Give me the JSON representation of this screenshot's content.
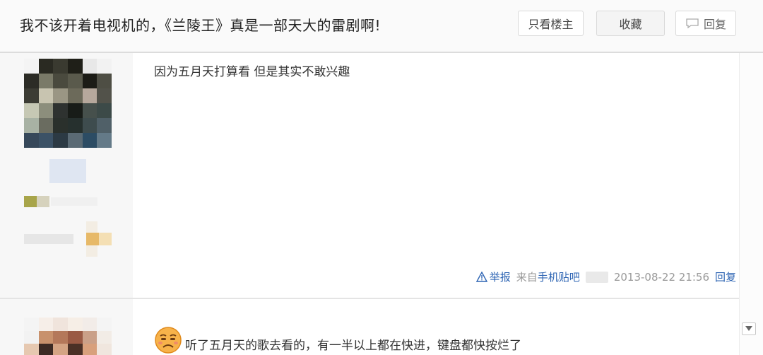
{
  "thread": {
    "title": "我不该开着电视机的，《兰陵王》真是一部天大的雷剧啊!",
    "buttons": {
      "only_owner": "只看楼主",
      "favorite": "收藏",
      "reply": "回复"
    }
  },
  "posts": [
    {
      "content": "因为五月天打算看 但是其实不敢兴趣",
      "tail": {
        "report": "举报",
        "source_prefix": "来自",
        "source": "手机贴吧",
        "datetime": "2013-08-22 21:56",
        "reply": "回复"
      }
    },
    {
      "content": "听了五月天的歌去看的，有一半以上都在快进，键盘都快按烂了",
      "emoji": "frowning-face"
    }
  ],
  "colors": {
    "link": "#2d64b3",
    "muted": "#999999",
    "author_bg": "#f7f7f7",
    "header_bg": "#fafafa"
  }
}
